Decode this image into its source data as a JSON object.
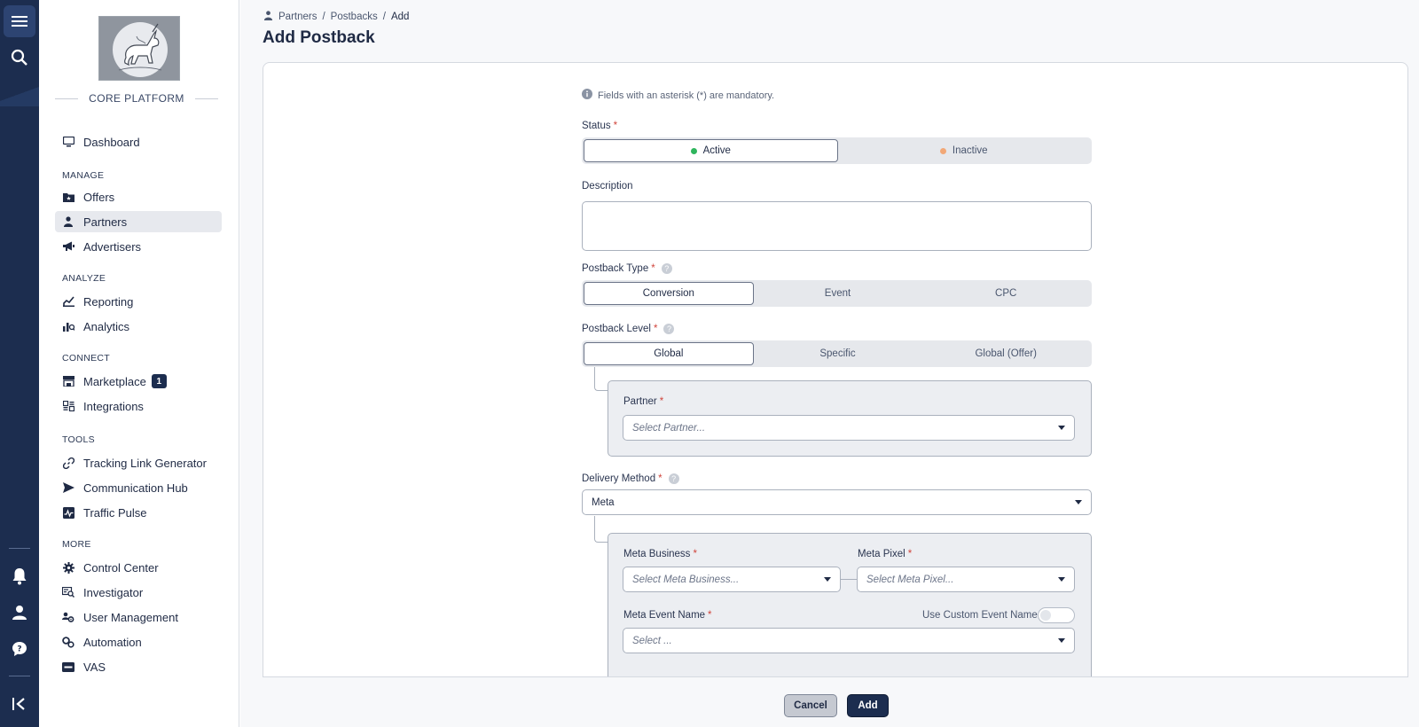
{
  "app": {
    "brand": "CORE PLATFORM"
  },
  "breadcrumb": [
    "Partners",
    "Postbacks",
    "Add"
  ],
  "page": {
    "title": "Add Postback"
  },
  "sidebar": {
    "top_items": [
      {
        "label": "Dashboard",
        "icon": "monitor-icon"
      }
    ],
    "sections": [
      {
        "title": "MANAGE",
        "items": [
          {
            "label": "Offers",
            "icon": "folder-star-icon"
          },
          {
            "label": "Partners",
            "icon": "partner-icon",
            "active": true
          },
          {
            "label": "Advertisers",
            "icon": "megaphone-icon"
          }
        ]
      },
      {
        "title": "ANALYZE",
        "items": [
          {
            "label": "Reporting",
            "icon": "chart-icon"
          },
          {
            "label": "Analytics",
            "icon": "analytics-icon"
          }
        ]
      },
      {
        "title": "CONNECT",
        "items": [
          {
            "label": "Marketplace",
            "icon": "store-icon",
            "badge": "1"
          },
          {
            "label": "Integrations",
            "icon": "integrations-icon"
          }
        ]
      },
      {
        "title": "TOOLS",
        "items": [
          {
            "label": "Tracking Link Generator",
            "icon": "link-icon"
          },
          {
            "label": "Communication Hub",
            "icon": "send-icon"
          },
          {
            "label": "Traffic Pulse",
            "icon": "pulse-icon"
          }
        ]
      },
      {
        "title": "MORE",
        "items": [
          {
            "label": "Control Center",
            "icon": "gear-icon"
          },
          {
            "label": "Investigator",
            "icon": "investigator-icon"
          },
          {
            "label": "User Management",
            "icon": "users-icon"
          },
          {
            "label": "Automation",
            "icon": "automation-icon"
          },
          {
            "label": "VAS",
            "icon": "vas-icon"
          }
        ]
      }
    ]
  },
  "form": {
    "note": "Fields with an asterisk (*) are mandatory.",
    "status": {
      "label": "Status",
      "options": [
        "Active",
        "Inactive"
      ],
      "selected": "Active",
      "colors": {
        "active": "#2fb55d",
        "inactive": "#f2a877"
      }
    },
    "description": {
      "label": "Description",
      "value": ""
    },
    "postback_type": {
      "label": "Postback Type",
      "options": [
        "Conversion",
        "Event",
        "CPC"
      ],
      "selected": "Conversion"
    },
    "postback_level": {
      "label": "Postback Level",
      "options": [
        "Global",
        "Specific",
        "Global (Offer)"
      ],
      "selected": "Global"
    },
    "partner": {
      "label": "Partner",
      "placeholder": "Select Partner..."
    },
    "delivery_method": {
      "label": "Delivery Method",
      "value": "Meta"
    },
    "meta_business": {
      "label": "Meta Business",
      "placeholder": "Select Meta Business..."
    },
    "meta_pixel": {
      "label": "Meta Pixel",
      "placeholder": "Select Meta Pixel..."
    },
    "meta_event_name": {
      "label": "Meta Event Name",
      "placeholder": "Select ..."
    },
    "custom_event": {
      "label": "Use Custom Event Name",
      "on": false
    }
  },
  "footer": {
    "cancel_label": "Cancel",
    "add_label": "Add"
  },
  "colors": {
    "navy": "#1c2d4f",
    "required": "#d0453c"
  }
}
